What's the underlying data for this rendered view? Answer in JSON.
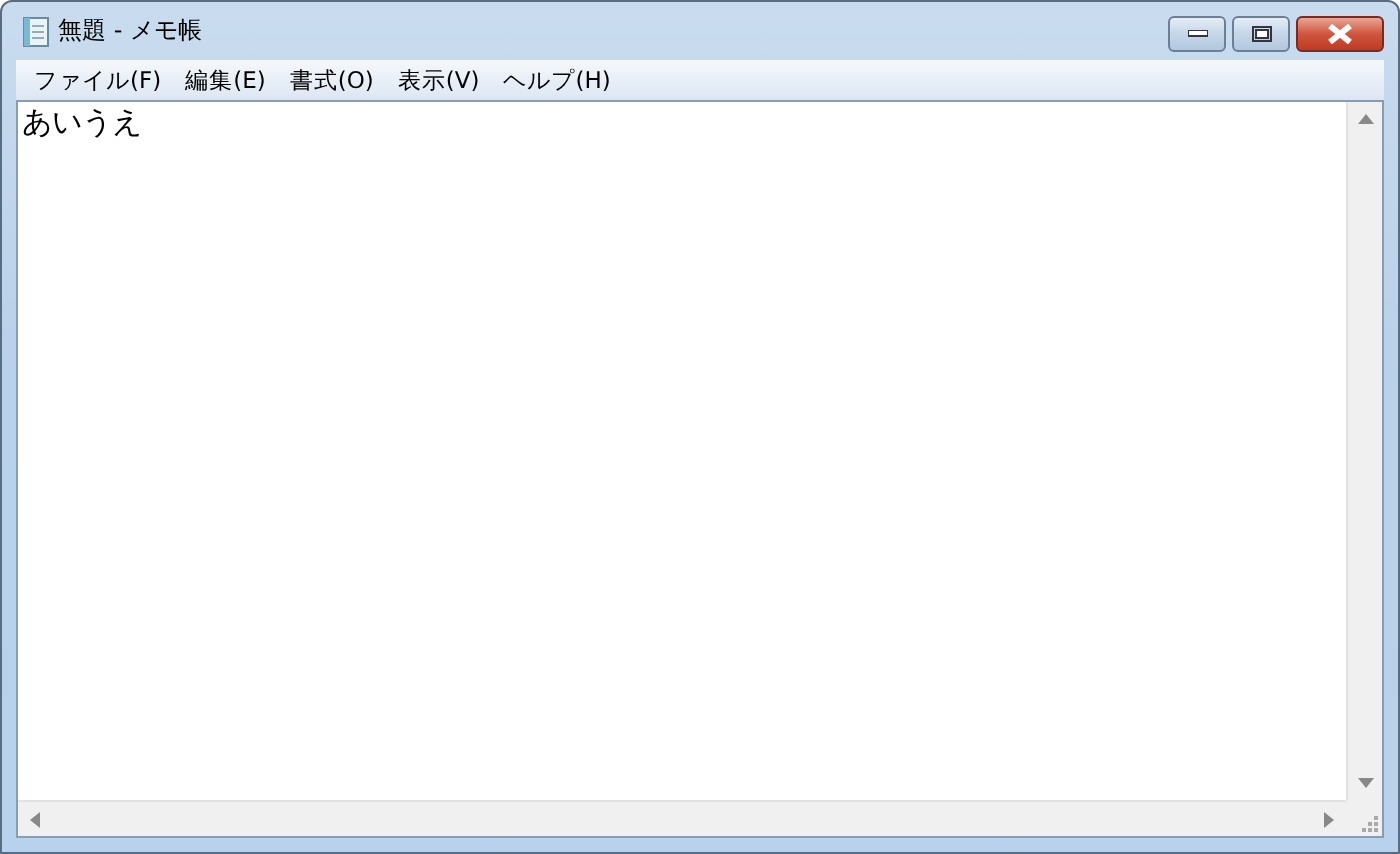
{
  "window": {
    "title": "無題 - メモ帳"
  },
  "menu": [
    "ファイル(F)",
    "編集(E)",
    "書式(O)",
    "表示(V)",
    "ヘルプ(H)"
  ],
  "editor": {
    "value": "あいうえ"
  }
}
